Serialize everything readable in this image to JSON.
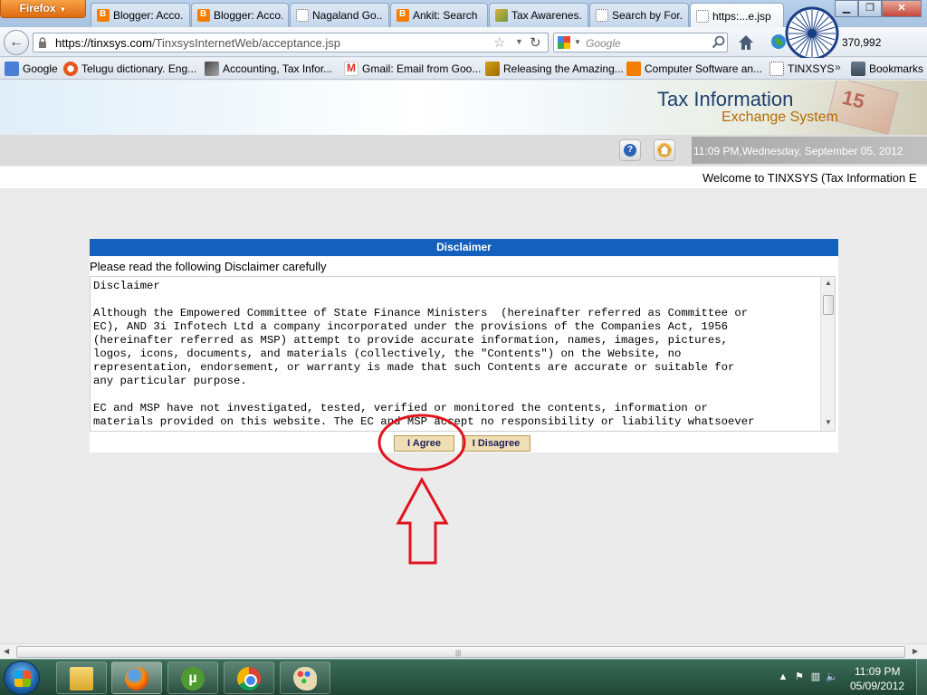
{
  "browser": {
    "menu_label": "Firefox",
    "tabs": [
      {
        "label": "Blogger: Acco...",
        "icon": "blogger-icon"
      },
      {
        "label": "Blogger: Acco...",
        "icon": "blogger-icon"
      },
      {
        "label": "Nagaland Go...",
        "icon": "page-icon"
      },
      {
        "label": "Ankit: Search ...",
        "icon": "blogger-icon"
      },
      {
        "label": "Tax Awarenes...",
        "icon": "tax-icon"
      },
      {
        "label": "Search by For...",
        "icon": "page-icon"
      },
      {
        "label": "https:...e.jsp",
        "icon": "page-icon",
        "active": true
      }
    ],
    "url_host": "https://tinxsys.com",
    "url_path": "/TinxsysInternetWeb/acceptance.jsp",
    "search_placeholder": "Google",
    "alexa_count": "370,992",
    "bookmarks": [
      {
        "label": "Google",
        "icon": "google-icon"
      },
      {
        "label": "Telugu dictionary. Eng...",
        "icon": "telugu-icon"
      },
      {
        "label": "Accounting, Tax Infor...",
        "icon": "accounting-icon"
      },
      {
        "label": "Gmail: Email from Goo...",
        "icon": "gmail-icon"
      },
      {
        "label": "Releasing the Amazing...",
        "icon": "release-icon"
      },
      {
        "label": "Computer Software an...",
        "icon": "blogger-icon"
      },
      {
        "label": "TINXSYS",
        "icon": "page-icon"
      },
      {
        "label": "Bookmarks",
        "icon": "bookmarks-icon"
      }
    ]
  },
  "site": {
    "brand_title": "Tax Information",
    "brand_subtitle": "Exchange System",
    "stamp_digits": "15",
    "datetime": "11:09 PM,Wednesday, September 05, 2012",
    "marquee": "Welcome to TINXSYS (Tax Information E"
  },
  "disclaimer": {
    "header": "Disclaimer",
    "intro": "Please read the following Disclaimer carefully",
    "body": "Disclaimer\n\nAlthough the Empowered Committee of State Finance Ministers  (hereinafter referred as Committee or\nEC), AND 3i Infotech Ltd a company incorporated under the provisions of the Companies Act, 1956\n(hereinafter referred as MSP) attempt to provide accurate information, names, images, pictures,\nlogos, icons, documents, and materials (collectively, the \"Contents\") on the Website, no\nrepresentation, endorsement, or warranty is made that such Contents are accurate or suitable for\nany particular purpose.\n\nEC and MSP have not investigated, tested, verified or monitored the contents, information or\nmaterials provided on this website. The EC and MSP accept no responsibility or liability whatsoever",
    "agree_label": "I Agree",
    "disagree_label": "I Disagree"
  },
  "annotation": {
    "color": "#e0141e"
  },
  "taskbar": {
    "apps": [
      "folder-icon",
      "firefox-icon",
      "utorrent-icon",
      "chrome-icon",
      "paint-icon"
    ],
    "time": "11:09 PM",
    "date": "05/09/2012"
  }
}
